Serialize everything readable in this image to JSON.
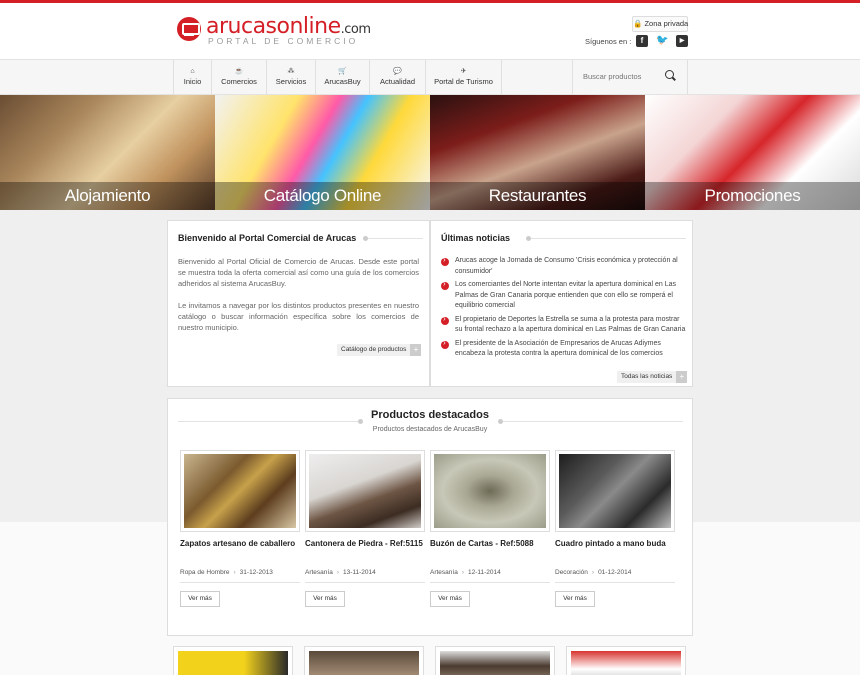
{
  "brand": {
    "name": "arucasonline",
    "domain": ".com",
    "tagline": "PORTAL DE COMERCIO",
    "accent": "#d41f26"
  },
  "header": {
    "zona_privada": "Zona privada",
    "follow_label": "Síguenos en :",
    "social": [
      "facebook-icon",
      "twitter-icon",
      "youtube-icon"
    ]
  },
  "nav": {
    "items": [
      {
        "label": "Inicio",
        "icon": "home-icon"
      },
      {
        "label": "Comercios",
        "icon": "coffee-icon"
      },
      {
        "label": "Servicios",
        "icon": "sitemap-icon"
      },
      {
        "label": "ArucasBuy",
        "icon": "cart-icon"
      },
      {
        "label": "Actualidad",
        "icon": "comments-icon"
      },
      {
        "label": "Portal de Turismo",
        "icon": "tourism-icon"
      }
    ],
    "search_placeholder": "Buscar productos"
  },
  "banners": [
    "Alojamiento",
    "Catálogo Online",
    "Restaurantes",
    "Promociones"
  ],
  "welcome": {
    "title": "Bienvenido al Portal Comercial de Arucas",
    "p1": "Bienvenido al Portal Oficial de Comercio de Arucas. Desde este portal se muestra toda la oferta comercial así como una guía de los comercios adheridos al sistema ArucasBuy.",
    "p2": "Le invitamos a navegar por los distintos productos presentes en nuestro catálogo o buscar información específica sobre los comercios de nuestro municipio.",
    "button": "Catálogo de productos"
  },
  "news": {
    "title": "Últimas noticias",
    "items": [
      "Arucas acoge la Jornada de Consumo 'Crisis económica y protección al consumidor'",
      "Los comerciantes del Norte intentan evitar la apertura dominical en Las Palmas de Gran Canaria porque entienden que con ello se romperá el equilibrio comercial",
      "El propietario de Deportes la Estrella se suma a la protesta para mostrar su frontal rechazo a la apertura dominical en Las Palmas de Gran Canaria",
      "El presidente de la Asociación de Empresarios de Arucas Adiymes encabeza la protesta contra la apertura dominical de los comercios"
    ],
    "button": "Todas las noticias"
  },
  "products": {
    "title": "Productos destacados",
    "subtitle": "Productos destacados de ArucasBuy",
    "more_label": "Ver más",
    "items": [
      {
        "name": "Zapatos artesano de caballero",
        "category": "Ropa de Hombre",
        "date": "31-12-2013"
      },
      {
        "name": "Cantonera de Piedra - Ref:5115",
        "category": "Artesanía",
        "date": "13-11-2014"
      },
      {
        "name": "Buzón de Cartas - Ref:5088",
        "category": "Artesanía",
        "date": "12-11-2014"
      },
      {
        "name": "Cuadro pintado a mano buda",
        "category": "Decoración",
        "date": "01-12-2014"
      }
    ]
  }
}
